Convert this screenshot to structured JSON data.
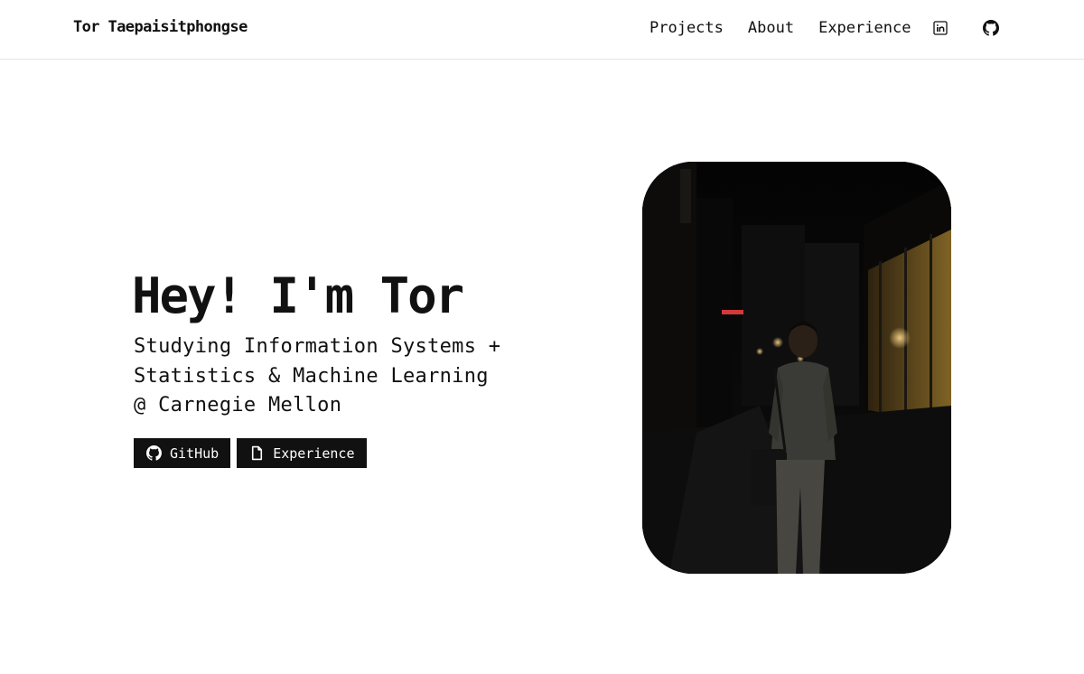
{
  "header": {
    "brand": "Tor Taepaisitphongse",
    "nav": {
      "projects": "Projects",
      "about": "About",
      "experience": "Experience"
    },
    "icons": [
      "linkedin-icon",
      "github-icon"
    ]
  },
  "hero": {
    "title": "Hey! I'm Tor",
    "subtitle_lines": [
      "Studying Information Systems +",
      "Statistics & Machine Learning",
      "@ Carnegie Mellon"
    ],
    "buttons": {
      "github": "GitHub",
      "experience": "Experience"
    }
  },
  "colors": {
    "text": "#111111",
    "button_bg": "#111111",
    "button_text": "#ffffff",
    "border": "#e6e6e6"
  }
}
